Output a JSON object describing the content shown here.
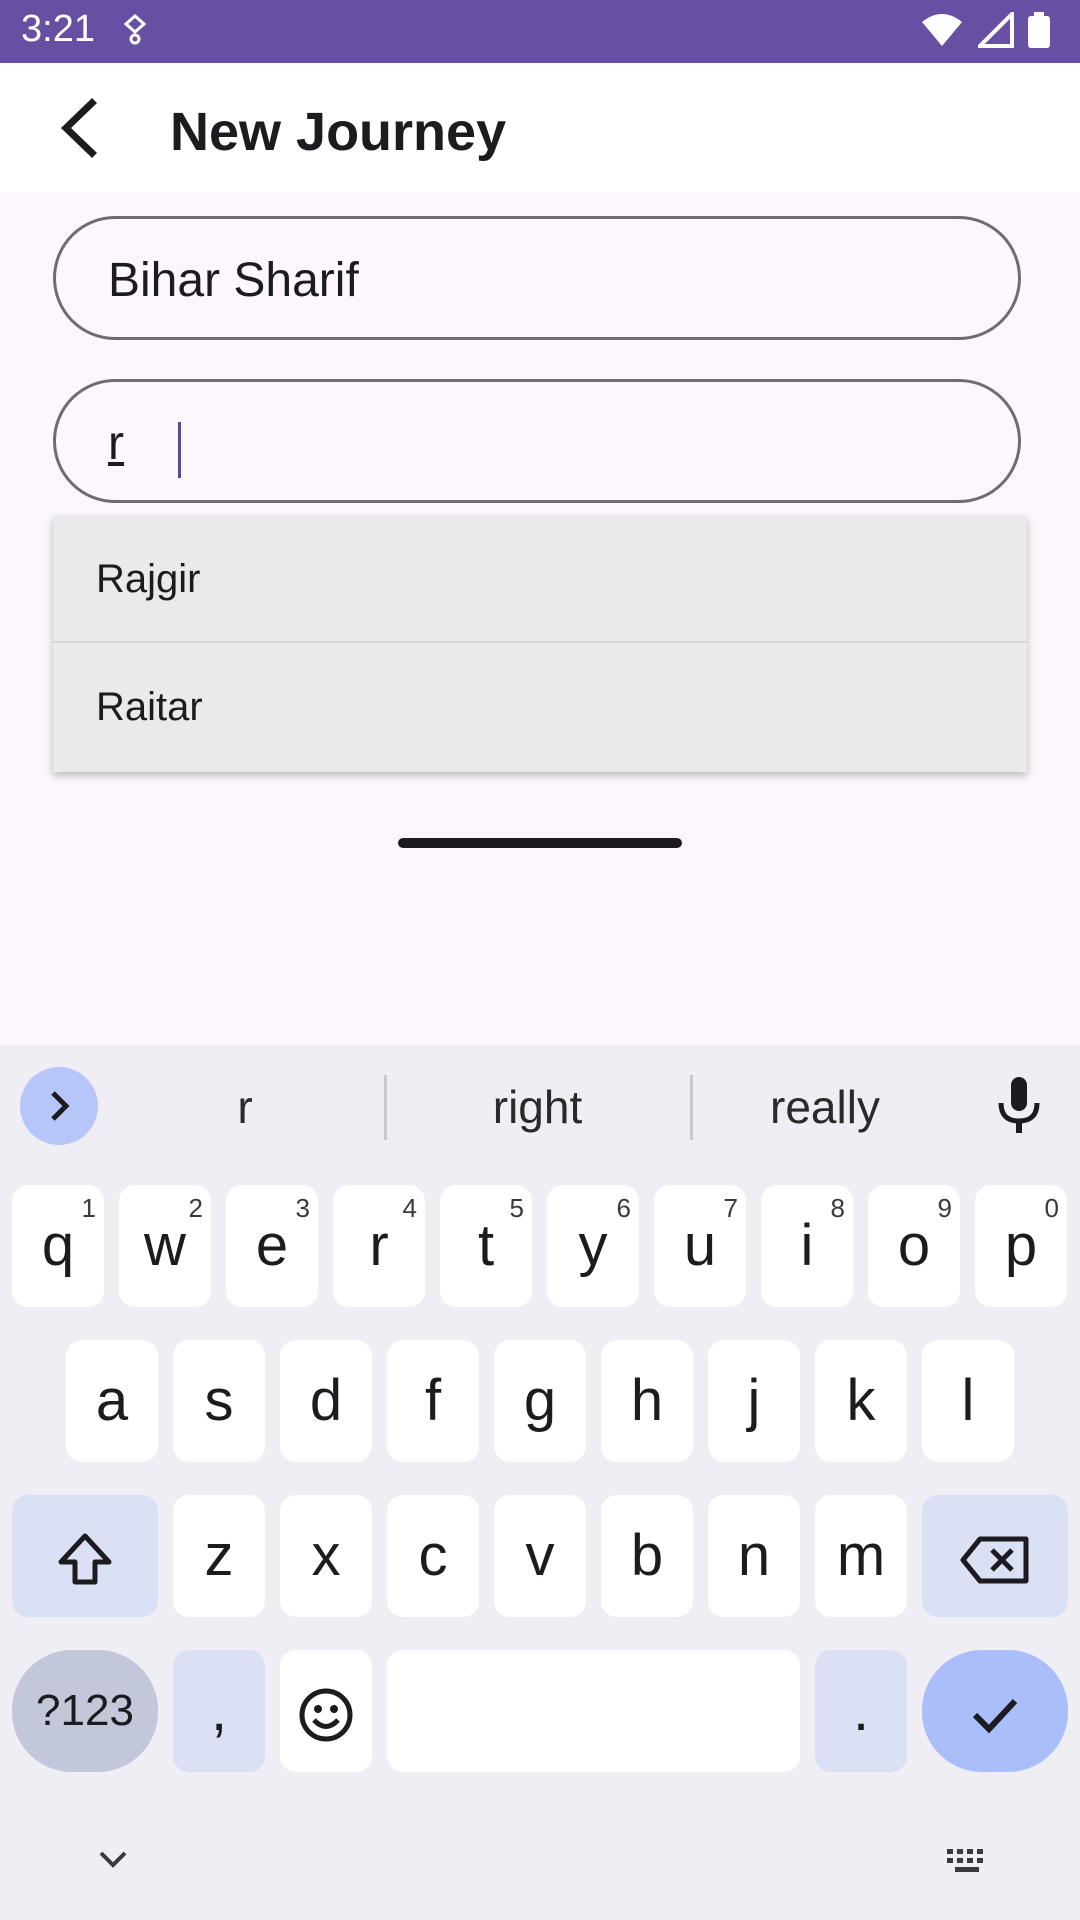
{
  "status": {
    "time": "3:21"
  },
  "appbar": {
    "title": "New Journey"
  },
  "form": {
    "from_value": "Bihar Sharif",
    "to_value": "r"
  },
  "suggestions_dropdown": [
    {
      "label": "Rajgir"
    },
    {
      "label": "Raitar"
    }
  ],
  "keyboard": {
    "suggestions": [
      "r",
      "right",
      "really"
    ],
    "row1": [
      {
        "k": "q",
        "n": "1"
      },
      {
        "k": "w",
        "n": "2"
      },
      {
        "k": "e",
        "n": "3"
      },
      {
        "k": "r",
        "n": "4"
      },
      {
        "k": "t",
        "n": "5"
      },
      {
        "k": "y",
        "n": "6"
      },
      {
        "k": "u",
        "n": "7"
      },
      {
        "k": "i",
        "n": "8"
      },
      {
        "k": "o",
        "n": "9"
      },
      {
        "k": "p",
        "n": "0"
      }
    ],
    "row2": [
      "a",
      "s",
      "d",
      "f",
      "g",
      "h",
      "j",
      "k",
      "l"
    ],
    "row3": [
      "z",
      "x",
      "c",
      "v",
      "b",
      "n",
      "m"
    ],
    "symbols_label": "?123",
    "comma": ",",
    "period": ".",
    "colors": {
      "accent": "#6750a4",
      "key_mod": "#dbe1f5",
      "key_action": "#aabefa"
    }
  }
}
